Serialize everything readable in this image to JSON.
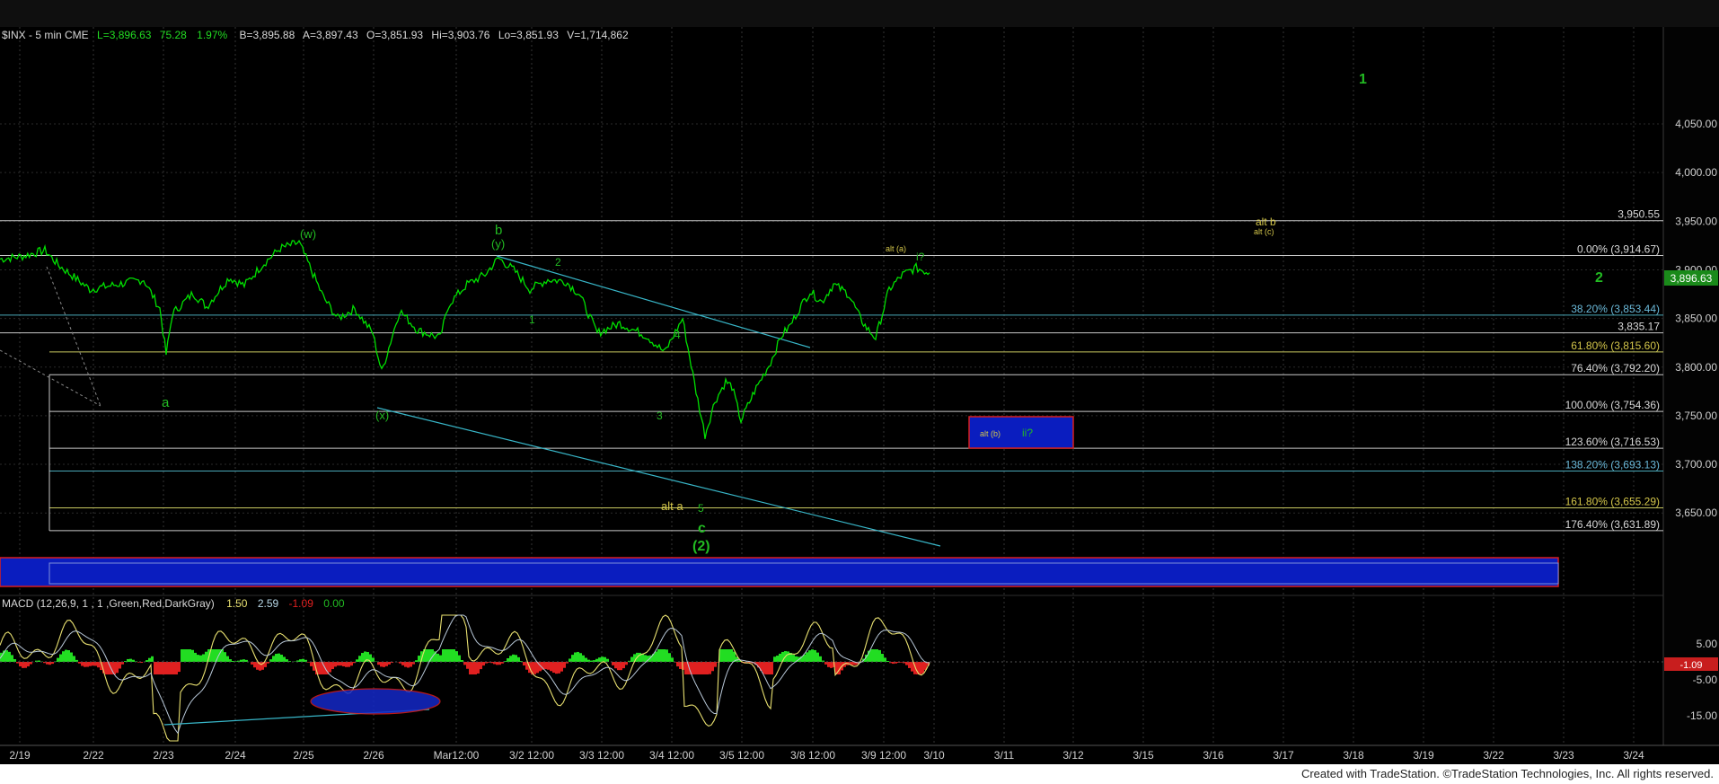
{
  "header": {
    "symbol": "$INX - 5 min  CME",
    "last": "L=3,896.63",
    "change": "75.28",
    "pct": "1.97%",
    "bid": "B=3,895.88",
    "ask": "A=3,897.43",
    "open": "O=3,851.93",
    "high": "Hi=3,903.76",
    "low": "Lo=3,851.93",
    "volume": "V=1,714,862"
  },
  "colors": {
    "background": "#000000",
    "price": "#00e000",
    "green_label": "#22bb22",
    "yellow_label": "#d4c64a",
    "channel": "#38b6c8",
    "band": "#0a1dbf",
    "band_border": "#d81e1e",
    "fib_label": "#8fa8e8",
    "axis_text": "#d0d0d0"
  },
  "macd": {
    "label": "MACD (12,26,9, 1 , 1 ,Green,Red,DarkGray)",
    "v1": "1.50",
    "v2": "2.59",
    "v3": "-1.09",
    "v4": "0.00",
    "current": "-1.09",
    "ticks": [
      "5.00",
      "-5.00",
      "-15.00"
    ]
  },
  "x_axis": [
    "2/19",
    "2/22",
    "2/23",
    "2/24",
    "2/25",
    "2/26",
    "Mar12:00",
    "3/2 12:00",
    "3/3 12:00",
    "3/4 12:00",
    "3/5 12:00",
    "3/8 12:00",
    "3/9 12:00",
    "3/10",
    "3/11",
    "3/12",
    "3/15",
    "3/16",
    "3/17",
    "3/18",
    "3/19",
    "3/22",
    "3/23",
    "3/24"
  ],
  "y_axis": [
    "4,050.00",
    "4,000.00",
    "3,950.00",
    "3,900.00",
    "3,850.00",
    "3,800.00",
    "3,750.00",
    "3,700.00",
    "3,650.00"
  ],
  "price_levels": [
    {
      "label": "3,950.55",
      "value": 3950.55
    },
    {
      "label": "0.00% (3,914.67)",
      "value": 3914.67
    },
    {
      "label": "38.20% (3,853.44)",
      "value": 3853.44
    },
    {
      "label": "3,835.17",
      "value": 3835.17
    },
    {
      "label": "61.80% (3,815.60)",
      "value": 3815.6
    },
    {
      "label": "76.40% (3,792.20)",
      "value": 3792.2
    },
    {
      "label": "100.00% (3,754.36)",
      "value": 3754.36
    },
    {
      "label": "123.60% (3,716.53)",
      "value": 3716.53
    },
    {
      "label": "138.20% (3,693.13)",
      "value": 3693.13
    },
    {
      "label": "161.80% (3,655.29)",
      "value": 3655.29
    },
    {
      "label": "176.40% (3,631.89)",
      "value": 3631.89
    }
  ],
  "last_price_tag": "3,896.63",
  "wave_labels": {
    "w": "(w)",
    "b": "b",
    "y": "(y)",
    "a": "a",
    "x": "(x)",
    "one": "1",
    "two": "2",
    "three": "3",
    "four": "4",
    "five": "5",
    "c": "c",
    "two_paren": "(2)",
    "alt_a": "alt a",
    "alt_a_paren": "alt (a)",
    "i_q": "i?",
    "alt_b": "alt b",
    "alt_c": "alt (c)",
    "big_one": "1",
    "big_two": "2",
    "alt_b_paren": "alt (b)",
    "ii_q": "ii?"
  },
  "footer": "Created with TradeStation. ©TradeStation Technologies, Inc. All rights reserved.",
  "chart_data": {
    "type": "line",
    "title": "$INX - 5 min",
    "x": [
      "2/19",
      "2/22",
      "2/23",
      "2/24",
      "2/25",
      "2/26",
      "3/1",
      "3/2",
      "3/3",
      "3/4",
      "3/5",
      "3/8",
      "3/9"
    ],
    "series": [
      {
        "name": "$INX",
        "values": [
          3918,
          3882,
          3812,
          3880,
          3925,
          3790,
          3905,
          3910,
          3860,
          3805,
          3724,
          3880,
          3897
        ]
      }
    ],
    "ylim": [
      3615,
      4110
    ],
    "grid": true
  }
}
